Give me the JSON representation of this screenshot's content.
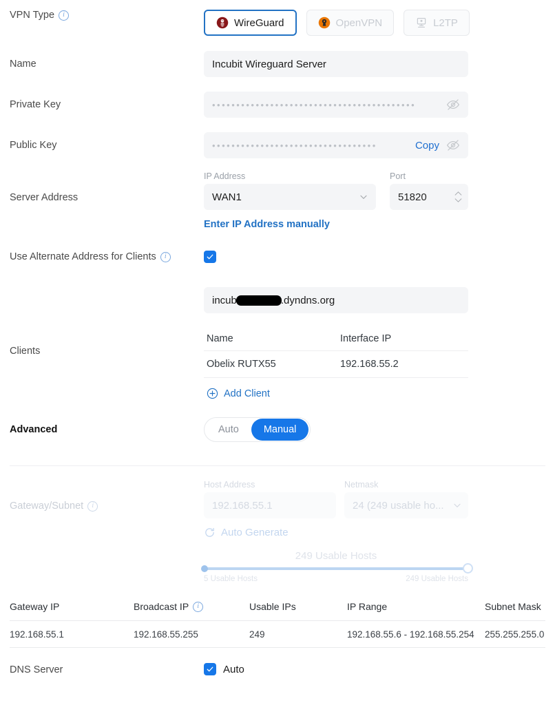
{
  "form": {
    "vpn_type": {
      "label": "VPN Type",
      "info_icon": "info-icon",
      "options": [
        {
          "id": "wireguard",
          "label": "WireGuard",
          "icon": "wireguard-icon",
          "selected": true
        },
        {
          "id": "openvpn",
          "label": "OpenVPN",
          "icon": "openvpn-icon",
          "selected": false
        },
        {
          "id": "l2tp",
          "label": "L2TP",
          "icon": "l2tp-icon",
          "selected": false
        }
      ]
    },
    "name": {
      "label": "Name",
      "value": "Incubit Wireguard Server"
    },
    "private_key": {
      "label": "Private Key",
      "masked_value": "••••••••••••••••••••••••••••••••••••••••••",
      "reveal_icon": "eye-off-icon"
    },
    "public_key": {
      "label": "Public Key",
      "masked_value": "••••••••••••••••••••••••••••••••••",
      "copy_label": "Copy",
      "reveal_icon": "eye-off-icon"
    },
    "server_address": {
      "label": "Server Address",
      "ip_address_label": "IP Address",
      "ip_address_value": "WAN1",
      "port_label": "Port",
      "port_value": "51820",
      "manual_link": "Enter IP Address manually"
    },
    "alternate_address": {
      "label": "Use Alternate Address for Clients",
      "checked": true,
      "value_prefix": "incub",
      "value_suffix": ".dyndns.org"
    },
    "clients": {
      "label": "Clients",
      "columns": [
        "Name",
        "Interface IP"
      ],
      "rows": [
        {
          "name": "Obelix RUTX55",
          "interface_ip": "192.168.55.2"
        }
      ],
      "add_label": "Add Client",
      "add_icon": "plus-circle-icon"
    },
    "advanced": {
      "label": "Advanced",
      "options": [
        "Auto",
        "Manual"
      ],
      "selected": "Manual"
    },
    "gateway_subnet": {
      "label": "Gateway/Subnet",
      "host_address_label": "Host Address",
      "host_address_value": "192.168.55.1",
      "netmask_label": "Netmask",
      "netmask_value": "24 (249 usable ho...",
      "auto_generate_label": "Auto Generate",
      "auto_generate_icon": "refresh-icon",
      "slider": {
        "caption": "249 Usable Hosts",
        "min_label": "5 Usable Hosts",
        "max_label": "249 Usable Hosts",
        "value_percent": 100
      }
    },
    "subnet_summary": {
      "columns": [
        "Gateway IP",
        "Broadcast IP",
        "Usable IPs",
        "IP Range",
        "Subnet Mask"
      ],
      "broadcast_info_icon": "info-icon",
      "rows": [
        {
          "gateway_ip": "192.168.55.1",
          "broadcast_ip": "192.168.55.255",
          "usable_ips": "249",
          "ip_range": "192.168.55.6 - 192.168.55.254",
          "subnet_mask": "255.255.255.0"
        }
      ]
    },
    "dns_server": {
      "label": "DNS Server",
      "auto_label": "Auto",
      "checked": true
    }
  },
  "colors": {
    "accent_blue": "#1677e8",
    "link_blue": "#2272c4",
    "field_bg": "#f4f5f7",
    "disabled_text": "#d5dae2",
    "wireguard_red": "#88171a",
    "openvpn_orange": "#ea7600"
  }
}
